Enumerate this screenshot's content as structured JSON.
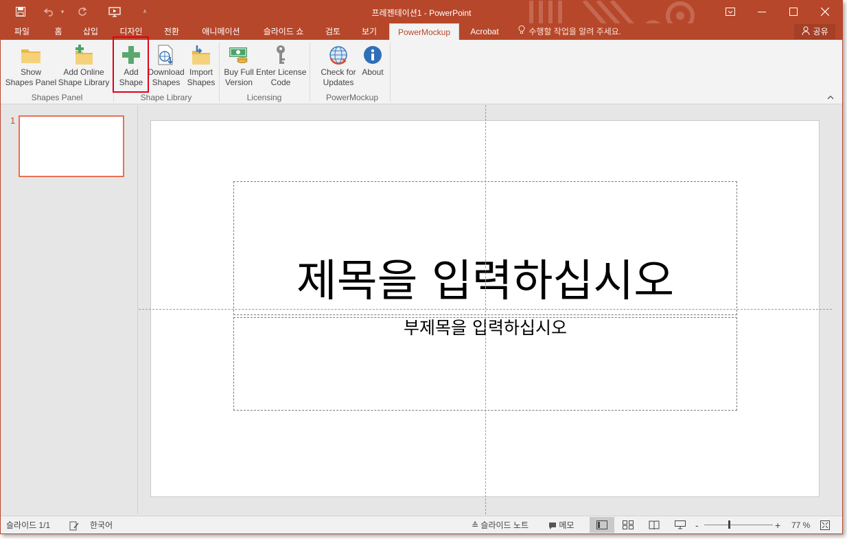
{
  "window": {
    "title": "프레젠테이션1 - PowerPoint",
    "accent_color": "#b7472a",
    "qat": [
      {
        "name": "save",
        "icon": "save-icon"
      },
      {
        "name": "undo",
        "icon": "undo-icon"
      },
      {
        "name": "redo",
        "icon": "redo-icon"
      },
      {
        "name": "present",
        "icon": "slideshow-icon"
      },
      {
        "name": "customize",
        "icon": "chevron-down-icon"
      }
    ],
    "controls": [
      "ribbon-display-icon",
      "minimize-icon",
      "maximize-icon",
      "close-icon"
    ]
  },
  "tabs": [
    {
      "label": "파일"
    },
    {
      "label": "홈"
    },
    {
      "label": "삽입"
    },
    {
      "label": "디자인"
    },
    {
      "label": "전환"
    },
    {
      "label": "애니메이션"
    },
    {
      "label": "슬라이드 쇼"
    },
    {
      "label": "검토"
    },
    {
      "label": "보기"
    },
    {
      "label": "PowerMockup",
      "active": true
    },
    {
      "label": "Acrobat"
    }
  ],
  "tell_me": "수행할 작업을 알려 주세요.",
  "share_label": "공유",
  "ribbon": {
    "groups": [
      {
        "label": "Shapes Panel",
        "buttons": [
          {
            "line1": "Show",
            "line2": "Shapes Panel",
            "icon": "folder-icon"
          }
        ]
      },
      {
        "label": "Shape Library",
        "buttons": [
          {
            "line1": "Add Online",
            "line2": "Shape Library",
            "icon": "folder-add-icon"
          },
          {
            "line1": "Add",
            "line2": "Shape",
            "icon": "plus-icon"
          },
          {
            "line1": "Download",
            "line2": "Shapes",
            "icon": "download-globe-icon"
          },
          {
            "line1": "Import",
            "line2": "Shapes",
            "icon": "import-folder-icon"
          }
        ]
      },
      {
        "label": "Licensing",
        "buttons": [
          {
            "line1": "Buy Full",
            "line2": "Version",
            "icon": "money-icon"
          },
          {
            "line1": "Enter License",
            "line2": "Code",
            "icon": "key-icon"
          }
        ]
      },
      {
        "label": "PowerMockup",
        "buttons": [
          {
            "line1": "Check for",
            "line2": "Updates",
            "icon": "globe-update-icon"
          },
          {
            "line1": "About",
            "line2": "",
            "icon": "info-icon"
          }
        ]
      }
    ]
  },
  "slides_panel": {
    "slide_number": "1"
  },
  "slide": {
    "title_placeholder": "제목을 입력하십시오",
    "subtitle_placeholder": "부제목을 입력하십시오"
  },
  "status": {
    "slide_counter": "슬라이드 1/1",
    "language": "한국어",
    "notes_label": "슬라이드 노트",
    "comments_label": "메모",
    "zoom_minus": "-",
    "zoom_plus": "+",
    "zoom_level": "77 %"
  }
}
